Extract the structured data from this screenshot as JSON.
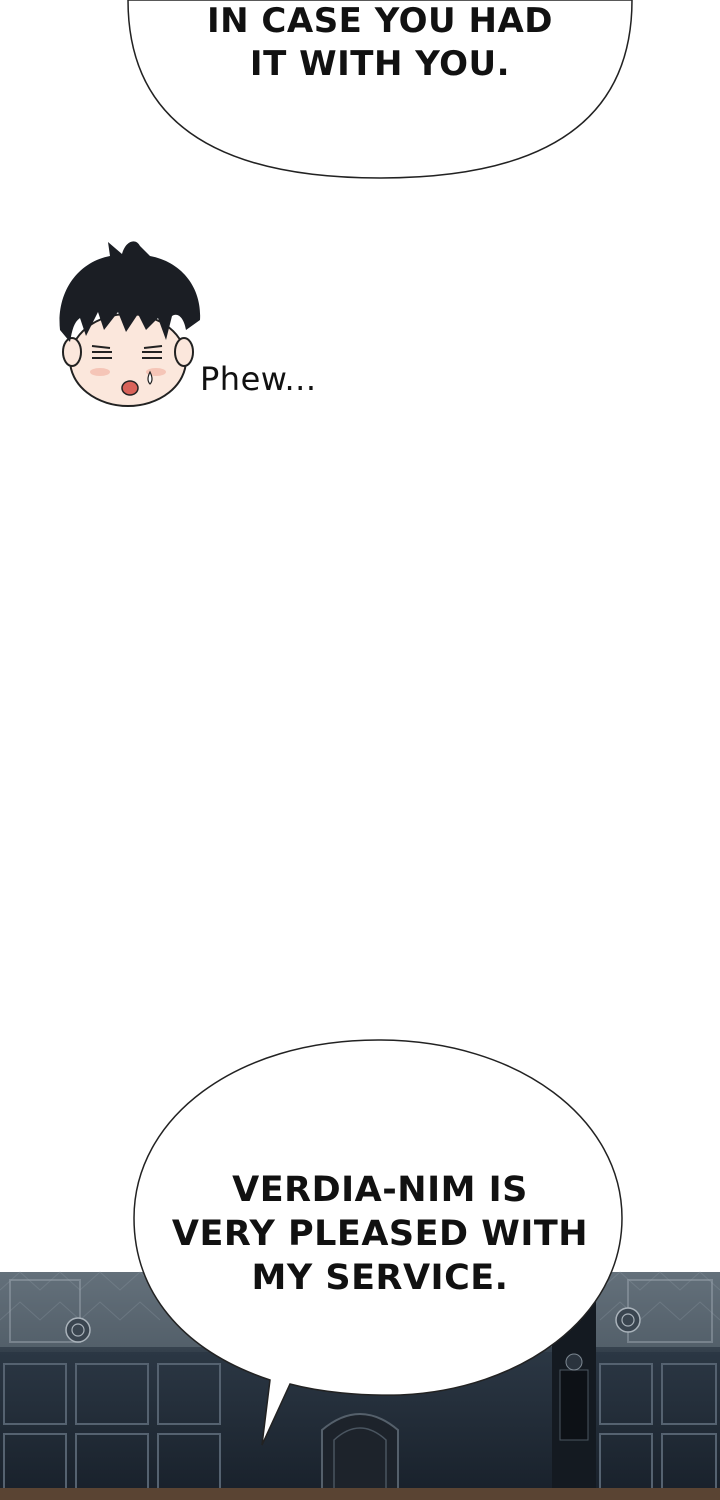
{
  "panel_top": {
    "speech_bubble": {
      "lines": [
        "IN CASE YOU HAD",
        "IT WITH YOU."
      ]
    },
    "sound_effect": "Phew..."
  },
  "panel_bottom": {
    "speech_bubble": {
      "lines": [
        "VERDIA-NIM IS",
        "VERY PLEASED WITH",
        "MY SERVICE."
      ]
    }
  },
  "colors": {
    "background": "#ffffff",
    "hair": "#1b1e24",
    "skin": "#fbe7dc",
    "blush": "#f2b7a6",
    "room_wall": "#2a3542",
    "room_floor": "#4a3a30"
  }
}
